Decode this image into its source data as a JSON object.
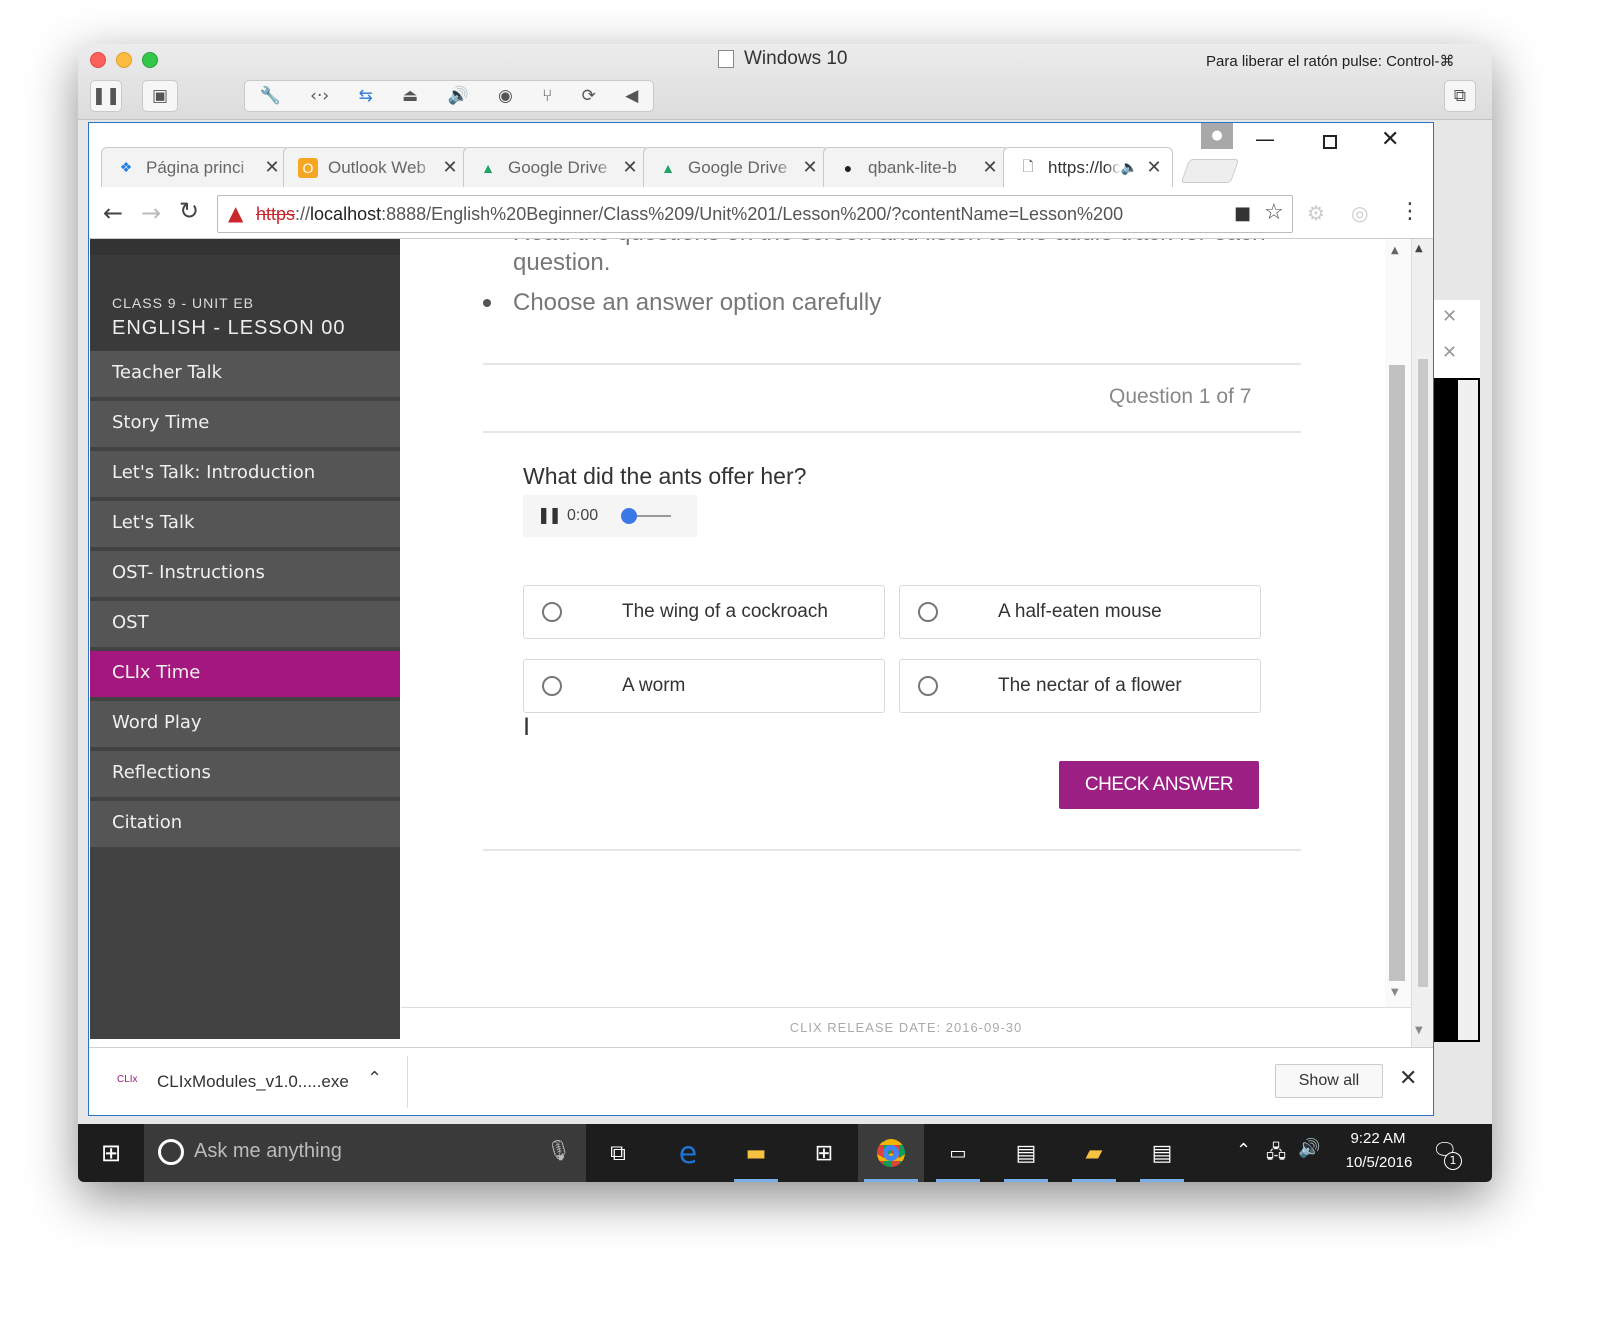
{
  "mac": {
    "title": "Windows 10",
    "hint": "Para liberar el ratón pulse: Control-⌘",
    "colors": {
      "close": "#fc605b",
      "minimize": "#fdbc40",
      "zoom": "#34c84a"
    }
  },
  "tabs": [
    {
      "label": "Página princi",
      "icon": "dropbox-icon",
      "active": false
    },
    {
      "label": "Outlook Web",
      "icon": "outlook-icon",
      "active": false
    },
    {
      "label": "Google Drive",
      "icon": "google-drive-icon",
      "active": false
    },
    {
      "label": "Google Drive",
      "icon": "google-drive-icon",
      "active": false
    },
    {
      "label": "qbank-lite-b",
      "icon": "github-icon",
      "active": false
    },
    {
      "label": "https://loc",
      "icon": "page-icon",
      "active": true
    }
  ],
  "address": {
    "scheme": "https",
    "rest_prefix": "://",
    "host": "localhost",
    "path": ":8888/English%20Beginner/Class%209/Unit%201/Lesson%200/?contentName=Lesson%200"
  },
  "sidebar": {
    "class_label": "CLASS 9 - UNIT EB",
    "lesson_label": "ENGLISH - LESSON 00",
    "items": [
      {
        "label": "Teacher Talk",
        "active": false
      },
      {
        "label": "Story Time",
        "active": false
      },
      {
        "label": "Let's Talk: Introduction",
        "active": false
      },
      {
        "label": "Let's Talk",
        "active": false
      },
      {
        "label": "OST- Instructions",
        "active": false
      },
      {
        "label": "OST",
        "active": false
      },
      {
        "label": "CLIx Time",
        "active": true
      },
      {
        "label": "Word Play",
        "active": false
      },
      {
        "label": "Reflections",
        "active": false
      },
      {
        "label": "Citation",
        "active": false
      }
    ]
  },
  "main": {
    "instructions_partial": "Read the questions on the screen and listen to the audio track for each",
    "instructions_line2": "question.",
    "instruction_bullet": "Choose an answer option carefully",
    "question_counter": "Question 1 of 7",
    "question_text": "What did the ants offer her?",
    "audio_time": "0:00",
    "audio_progress": 0,
    "options": [
      "The wing of a cockroach",
      "A half-eaten mouse",
      "A worm",
      "The nectar of a flower"
    ],
    "check_label": "CHECK ANSWER",
    "release": "CLIX RELEASE DATE: 2016-09-30",
    "accent": "#9c1f83"
  },
  "download": {
    "badge": "CLIx",
    "filename": "CLIxModules_v1.0.....exe",
    "show_all": "Show all"
  },
  "taskbar": {
    "search_placeholder": "Ask me anything",
    "time": "9:22 AM",
    "date": "10/5/2016",
    "notification_count": "1"
  }
}
